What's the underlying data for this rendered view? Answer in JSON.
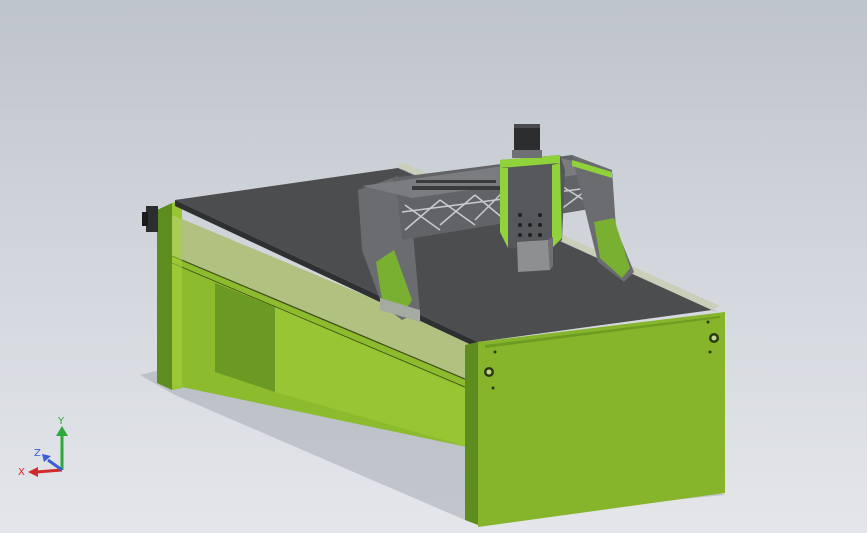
{
  "viewport": {
    "background_top": "#bec3cc",
    "background_bottom": "#e4e6ea"
  },
  "model": {
    "frame_color": "#8ab82a",
    "frame_shade_color": "#5c8a1f",
    "bed_color": "#4e4f50",
    "gantry_color": "#6b6d70",
    "spindle_color": "#8e8f91",
    "motor_color": "#2c2d2f"
  },
  "triad": {
    "x_label": "X",
    "y_label": "Y",
    "z_label": "Z",
    "x_color": "#d22b2b",
    "y_color": "#2fa83a",
    "z_color": "#3a5fd2"
  }
}
